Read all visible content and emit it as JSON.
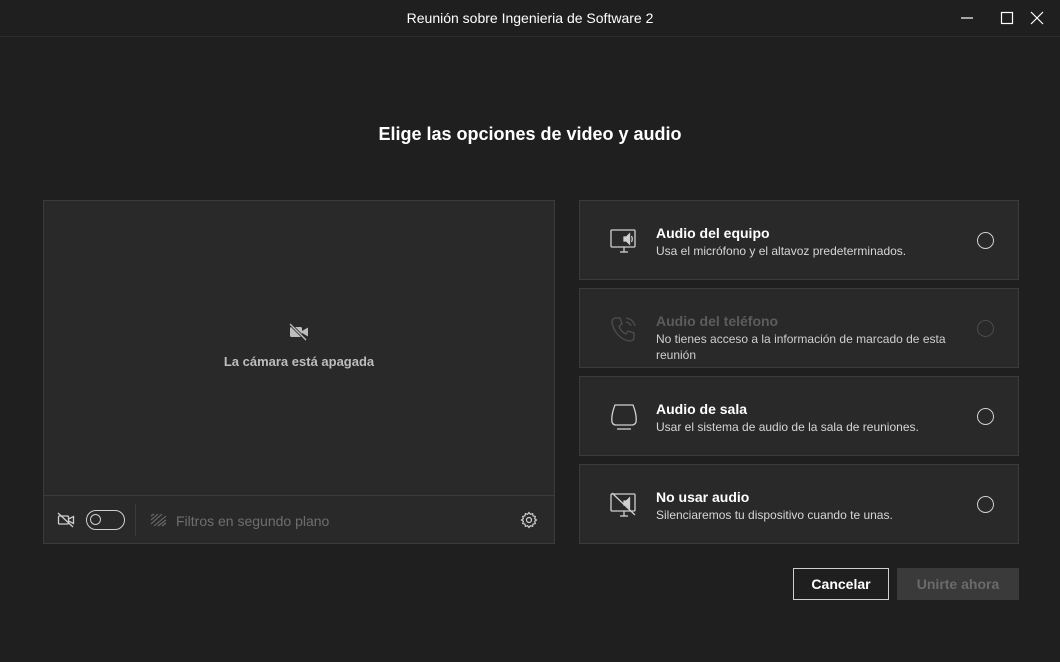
{
  "window": {
    "title": "Reunión sobre Ingenieria de Software 2",
    "controls": [
      "minimize-icon",
      "maximize-icon",
      "close-icon"
    ]
  },
  "heading": "Elige las opciones de video y audio",
  "video": {
    "camera_off_text": "La cámara está apagada",
    "camera_toggle_on": false,
    "filters_label": "Filtros en segundo plano"
  },
  "audio_options": [
    {
      "icon": "computer-audio-icon",
      "title": "Audio del equipo",
      "description": "Usa el micrófono y el altavoz predeterminados.",
      "selected": false,
      "enabled": true
    },
    {
      "icon": "phone-icon",
      "title": "Audio del teléfono",
      "description": "No tienes acceso a la información de marcado de esta reunión",
      "selected": false,
      "enabled": false
    },
    {
      "icon": "room-audio-icon",
      "title": "Audio de sala",
      "description": "Usar el sistema de audio de la sala de reuniones.",
      "selected": false,
      "enabled": true
    },
    {
      "icon": "no-audio-icon",
      "title": "No usar audio",
      "description": "Silenciaremos tu dispositivo cuando te unas.",
      "selected": false,
      "enabled": true
    }
  ],
  "actions": {
    "cancel_label": "Cancelar",
    "join_label": "Unirte ahora",
    "join_enabled": false
  },
  "colors": {
    "background": "#1f1f1f",
    "panel": "#292929",
    "border": "#3b3b3b",
    "disabled_text": "#5c5c5c"
  }
}
